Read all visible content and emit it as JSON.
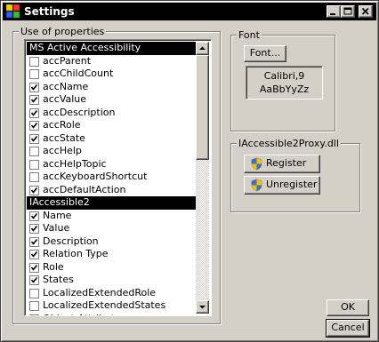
{
  "window": {
    "title": "Settings"
  },
  "properties_group": {
    "legend": "Use of properties",
    "sections": [
      {
        "header": "MS Active Accessibility",
        "items": [
          {
            "label": "accParent",
            "checked": false
          },
          {
            "label": "accChildCount",
            "checked": false
          },
          {
            "label": "accName",
            "checked": true
          },
          {
            "label": "accValue",
            "checked": true
          },
          {
            "label": "accDescription",
            "checked": true
          },
          {
            "label": "accRole",
            "checked": true
          },
          {
            "label": "accState",
            "checked": true
          },
          {
            "label": "accHelp",
            "checked": false
          },
          {
            "label": "accHelpTopic",
            "checked": false
          },
          {
            "label": "accKeyboardShortcut",
            "checked": false
          },
          {
            "label": "accDefaultAction",
            "checked": true
          }
        ]
      },
      {
        "header": "IAccessible2",
        "items": [
          {
            "label": "Name",
            "checked": true
          },
          {
            "label": "Value",
            "checked": true
          },
          {
            "label": "Description",
            "checked": true
          },
          {
            "label": "Relation Type",
            "checked": true
          },
          {
            "label": "Role",
            "checked": true
          },
          {
            "label": "States",
            "checked": true
          },
          {
            "label": "LocalizedExtendedRole",
            "checked": false
          },
          {
            "label": "LocalizedExtendedStates",
            "checked": false
          },
          {
            "label": "Object Attributes",
            "checked": true
          }
        ]
      }
    ]
  },
  "font_group": {
    "legend": "Font",
    "button_label": "Font...",
    "preview_line1": "Calibri,9",
    "preview_line2": "AaBbYyZz"
  },
  "proxy_group": {
    "legend": "IAccessible2Proxy.dll",
    "register_label": "Register",
    "unregister_label": "Unregister"
  },
  "footer": {
    "ok_label": "OK",
    "cancel_label": "Cancel"
  }
}
